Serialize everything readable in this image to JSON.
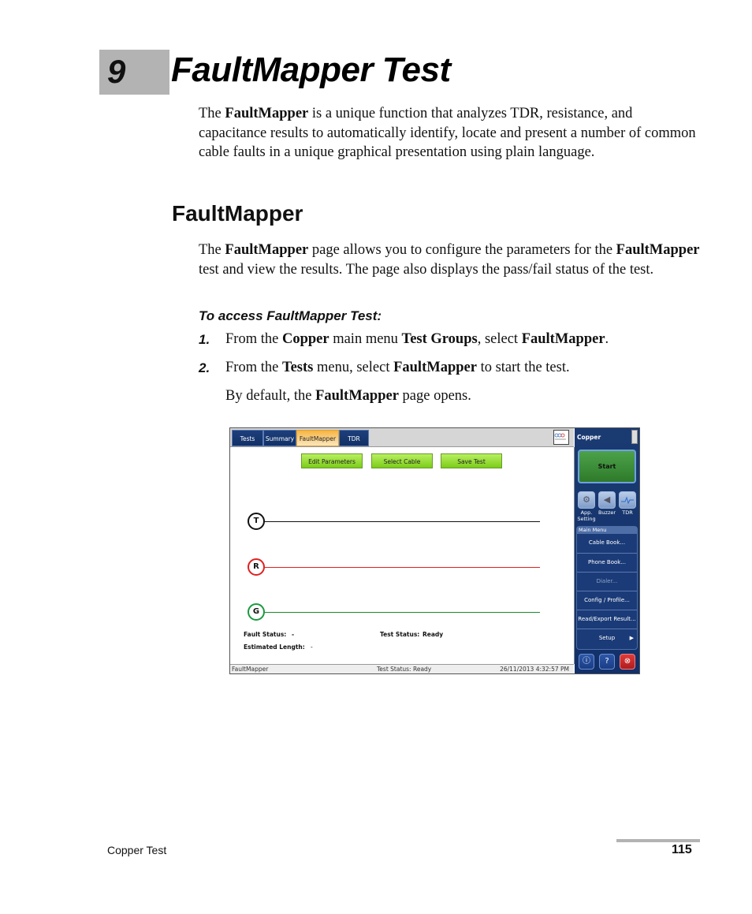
{
  "chapter": {
    "number": "9",
    "title": "FaultMapper Test"
  },
  "intro": {
    "parts": [
      "The ",
      "FaultMapper",
      " is a unique function that analyzes TDR, resistance, and capacitance results to automatically identify, locate and present a number of common cable faults in a unique graphical presentation using plain language."
    ]
  },
  "section": {
    "heading": "FaultMapper",
    "para_parts": [
      "The ",
      "FaultMapper",
      " page allows you to configure the parameters for the ",
      "FaultMapper",
      " test and view the results. The page also displays the pass/fail status of the test."
    ]
  },
  "procedure": {
    "title": "To access FaultMapper Test:",
    "steps": [
      {
        "num": "1.",
        "parts": [
          "From the ",
          "Copper",
          " main menu ",
          "Test Groups",
          ", select ",
          "FaultMapper",
          "."
        ]
      },
      {
        "num": "2.",
        "parts": [
          "From the ",
          "Tests",
          " menu, select ",
          "FaultMapper",
          " to start the test."
        ]
      }
    ],
    "note_parts": [
      "By default, the ",
      "FaultMapper",
      " page opens."
    ]
  },
  "screenshot": {
    "tabs": [
      {
        "label": "Tests",
        "active": false
      },
      {
        "label": "Summary",
        "active": false
      },
      {
        "label": "FaultMapper",
        "active": true
      },
      {
        "label": "TDR",
        "active": false
      }
    ],
    "buttons": {
      "edit": "Edit Parameters",
      "select_cable": "Select Cable",
      "save": "Save Test"
    },
    "wires": [
      {
        "label": "T",
        "color": "#111111"
      },
      {
        "label": "R",
        "color": "#e02020"
      },
      {
        "label": "G",
        "color": "#1a8a2a"
      }
    ],
    "fault_status_label": "Fault Status:",
    "fault_status_value": "-",
    "test_status_label": "Test Status:",
    "test_status_value": "Ready",
    "est_length_label": "Estimated Length:",
    "est_length_value": "-",
    "statusbar": {
      "left": "FaultMapper",
      "center": "Test Status: Ready",
      "right": "26/11/2013 4:32:57 PM"
    },
    "side": {
      "title": "Copper",
      "start": "Start",
      "icons": [
        {
          "label": "App. Setting",
          "icon": "wrench-icon"
        },
        {
          "label": "Buzzer",
          "icon": "speaker-icon"
        },
        {
          "label": "TDR",
          "icon": "tdr-waveform-icon"
        }
      ],
      "menu_title": "Main Menu",
      "menu_items": [
        {
          "label": "Cable Book...",
          "disabled": false
        },
        {
          "label": "Phone Book...",
          "disabled": false
        },
        {
          "label": "Dialer...",
          "disabled": true
        },
        {
          "label": "Config / Profile...",
          "disabled": false
        },
        {
          "label": "Read/Export Result...",
          "disabled": false
        },
        {
          "label": "Setup",
          "disabled": false,
          "submenu": true
        }
      ]
    }
  },
  "footer": {
    "left": "Copper Test",
    "page": "115"
  }
}
